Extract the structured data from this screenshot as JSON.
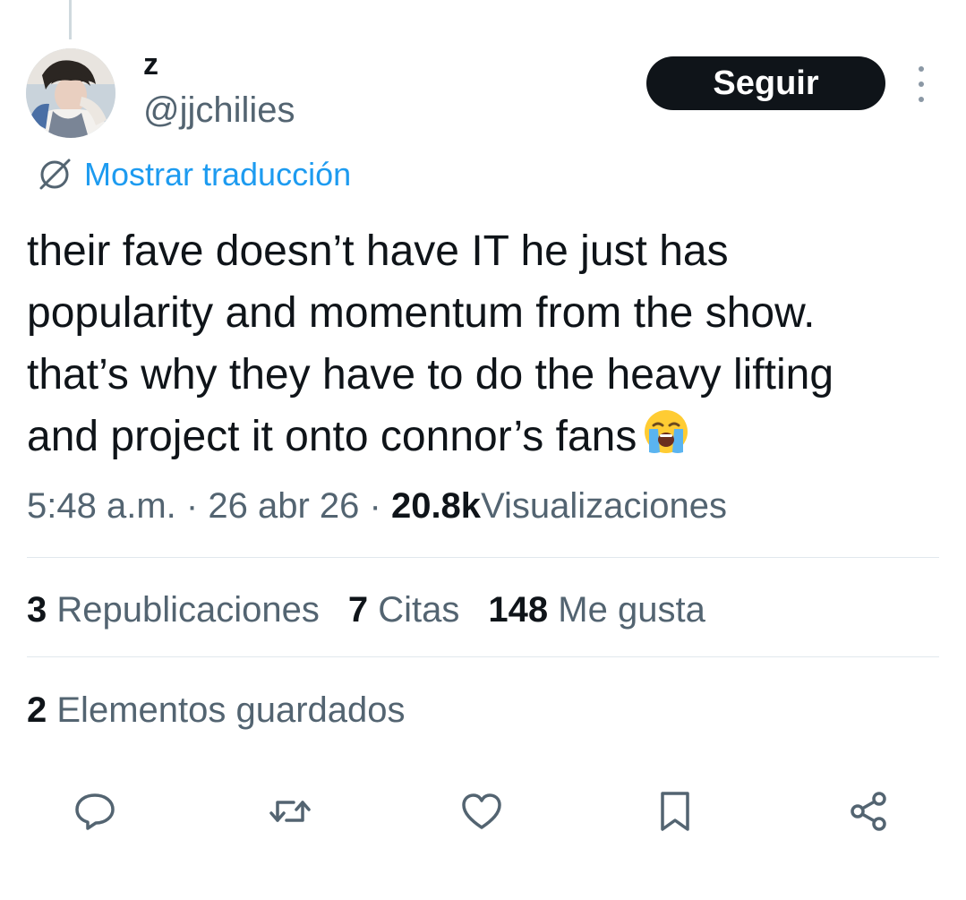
{
  "tweet": {
    "display_name": "z",
    "handle": "@jjchilies",
    "follow_label": "Seguir",
    "translate_label": "Mostrar traducción",
    "text_lines": [
      "their fave doesn’t have IT he just has",
      "popularity and momentum from the show.",
      "that’s why they have to do the heavy lifting",
      "and project it onto connor’s fans"
    ],
    "emoji": "loudly-crying-face",
    "time": "5:48 a.m.",
    "date": "26 abr 26",
    "separator": "·",
    "views_count": "20.8k",
    "views_label": "Visualizaciones"
  },
  "stats": {
    "reposts_count": "3",
    "reposts_label": "Republicaciones",
    "quotes_count": "7",
    "quotes_label": "Citas",
    "likes_count": "148",
    "likes_label": "Me gusta",
    "bookmarks_count": "2",
    "bookmarks_label": "Elementos guardados"
  },
  "actions": [
    "reply-icon",
    "repost-icon",
    "like-icon",
    "bookmark-icon",
    "share-icon"
  ],
  "colors": {
    "link": "#1d9bf0",
    "secondary_text": "#536471",
    "icon": "#536471",
    "button_bg": "#0f1419",
    "divider": "#e1e8ed"
  }
}
